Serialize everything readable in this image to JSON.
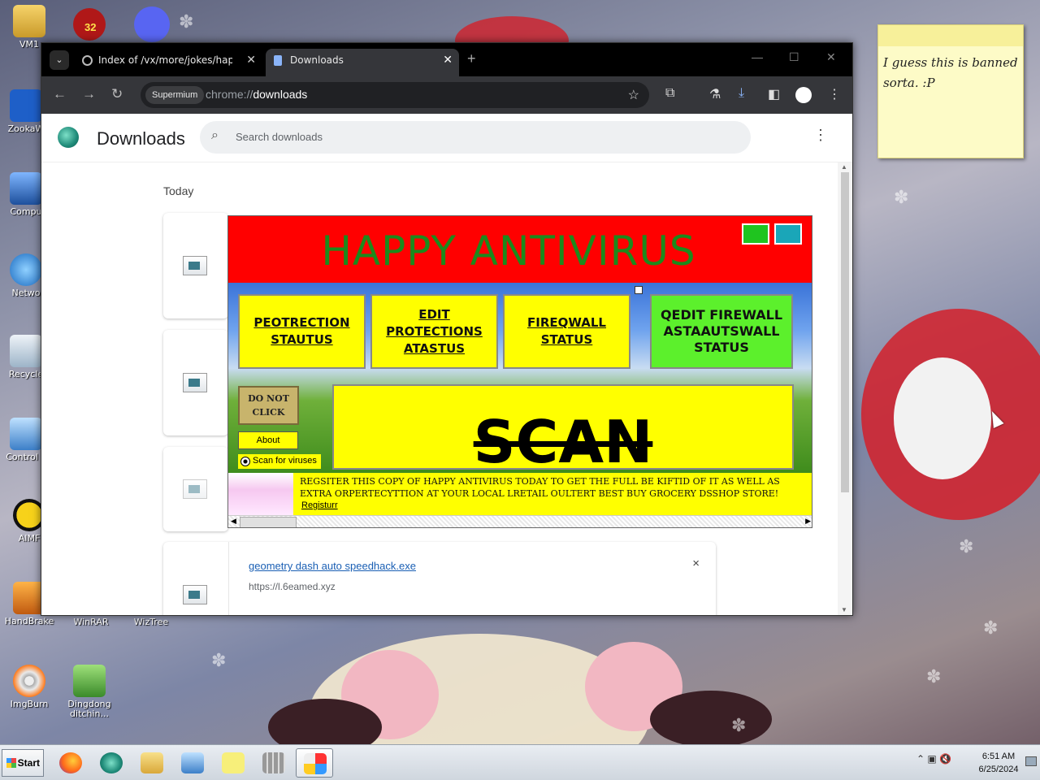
{
  "desktop": {
    "icons": [
      {
        "label": "VM1"
      },
      {
        "label": "ZookaW"
      },
      {
        "label": "Compu"
      },
      {
        "label": "Netwo"
      },
      {
        "label": "Recycle"
      },
      {
        "label": "Control F"
      },
      {
        "label": "AIMF"
      },
      {
        "label": "HandBrake"
      },
      {
        "label": "WinRAR"
      },
      {
        "label": "WizTree"
      },
      {
        "label": "ImgBurn"
      },
      {
        "label": "Dingdong ditchin..."
      }
    ],
    "badge_count": "32",
    "sticky_note": "I guess this is banned sorta. :P"
  },
  "browser": {
    "tabs": [
      {
        "title": "Index of /vx/more/jokes/happy an",
        "active": false
      },
      {
        "title": "Downloads",
        "active": true
      }
    ],
    "new_tab": "+",
    "site_chip": "Supermium",
    "url_scheme": "chrome://",
    "url_path": "downloads"
  },
  "downloads_page": {
    "title": "Downloads",
    "search_placeholder": "Search downloads",
    "section_date": "Today",
    "last_item": {
      "name": "geometry dash auto speedhack.exe",
      "source": "https://l.6eamed.xyz",
      "close": "×"
    }
  },
  "happy_antivirus": {
    "title": "HAPPY ANTIVIRUS",
    "title_color": "#1c8a1c",
    "header_color": "#ff0000",
    "buttons": [
      {
        "label": "PEOTRECTION STAUTUS"
      },
      {
        "label": "EDIT PROTECTIONS ATASTUS"
      },
      {
        "label": "FIREQWALL STATUS"
      },
      {
        "label": "QEDIT FIREWALL ASTAAUTSWALL STATUS"
      }
    ],
    "do_not_click": "DO NOT CLICK",
    "about": "About",
    "scan_option": "Scan for viruses",
    "scan": "SCAN",
    "banner_text": "REGSITER THIS COPY OF HAPPY ANTIVIRUS TODAY TO GET THE FULL BE KIFTID OF IT AS WELL AS EXTRA ORPERTECYTTION AT YOUR LOCAL LRETAIL OULTERT BEST BUY GROCERY DSSHOP STORE!",
    "register_link": "Registurr"
  },
  "taskbar": {
    "start": "Start",
    "time": "6:51 AM",
    "date": "6/25/2024"
  }
}
